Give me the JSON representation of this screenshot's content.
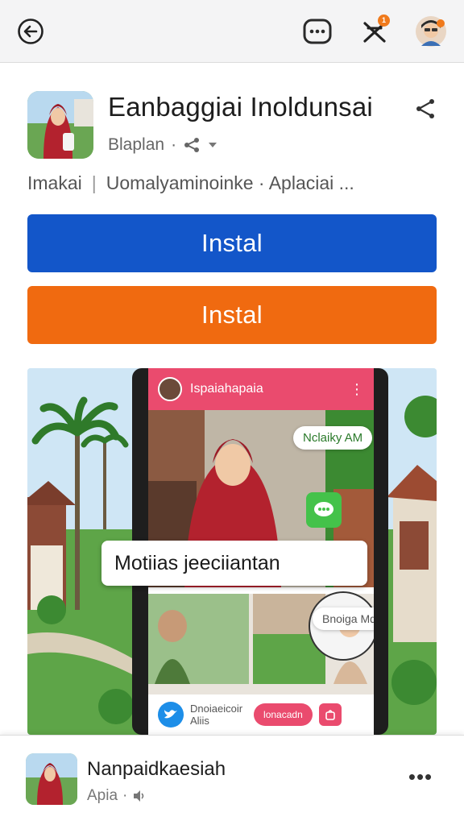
{
  "header": {
    "notification_count": "1"
  },
  "app": {
    "title": "Eanbaggiai Inoldunsai",
    "developer": "Blaplan",
    "meta_left": "Imakai",
    "meta_right": "Uomalyaminoinke · Aplaciai ..."
  },
  "buttons": {
    "install_primary": "Instal",
    "install_secondary": "Instal"
  },
  "screenshot": {
    "header_title": "Ispaiahapaia",
    "chip_top": "Nclaiky AM",
    "caption": "Motiias jeeciiantan",
    "chip_mid": "Bnoiga Mdodi",
    "bottom_text_1": "Dnoiaeicoir",
    "bottom_text_2": "Aliis",
    "pill_label": "lonacadn"
  },
  "bottom_card": {
    "title": "Nanpaidkaesiah",
    "subtitle": "Apia",
    "more": "•••"
  },
  "colors": {
    "primary_button": "#1356c9",
    "secondary_button": "#f06a10",
    "screen_accent": "#ea4b6e"
  }
}
